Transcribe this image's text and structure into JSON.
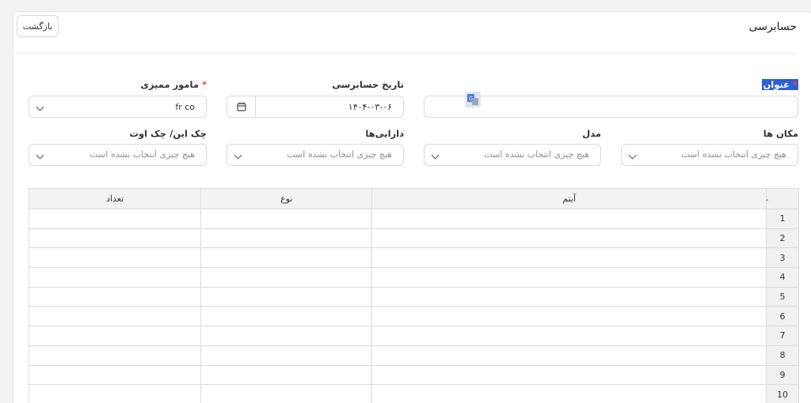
{
  "header": {
    "title": "حسابرسی",
    "back_label": "بازگشت"
  },
  "form": {
    "title_label": "عنوان",
    "date_label": "تاریخ حسابرسی",
    "date_value": "۱۴۰۴-۰۳-۰۶",
    "auditor_label": "مامور ممیزی",
    "auditor_value": "fr co",
    "places_label": "مکان ها",
    "model_label": "مدل",
    "assets_label": "دارایی‌ها",
    "checkinout_label": "چک این/ چک اوت",
    "placeholder": "هیچ چیزی انتخاب نشده است"
  },
  "table": {
    "columns": [
      "تعداد",
      "نوع",
      "آیتم"
    ],
    "row_numbers": [
      "1",
      "2",
      "3",
      "4",
      "5",
      "6",
      "7",
      "8",
      "9",
      "10"
    ]
  },
  "colors": {
    "accent": "#2f5fd0",
    "required": "#e5484d"
  },
  "icons": [
    "calendar-icon",
    "chevron-down-icon",
    "translate-icon"
  ]
}
